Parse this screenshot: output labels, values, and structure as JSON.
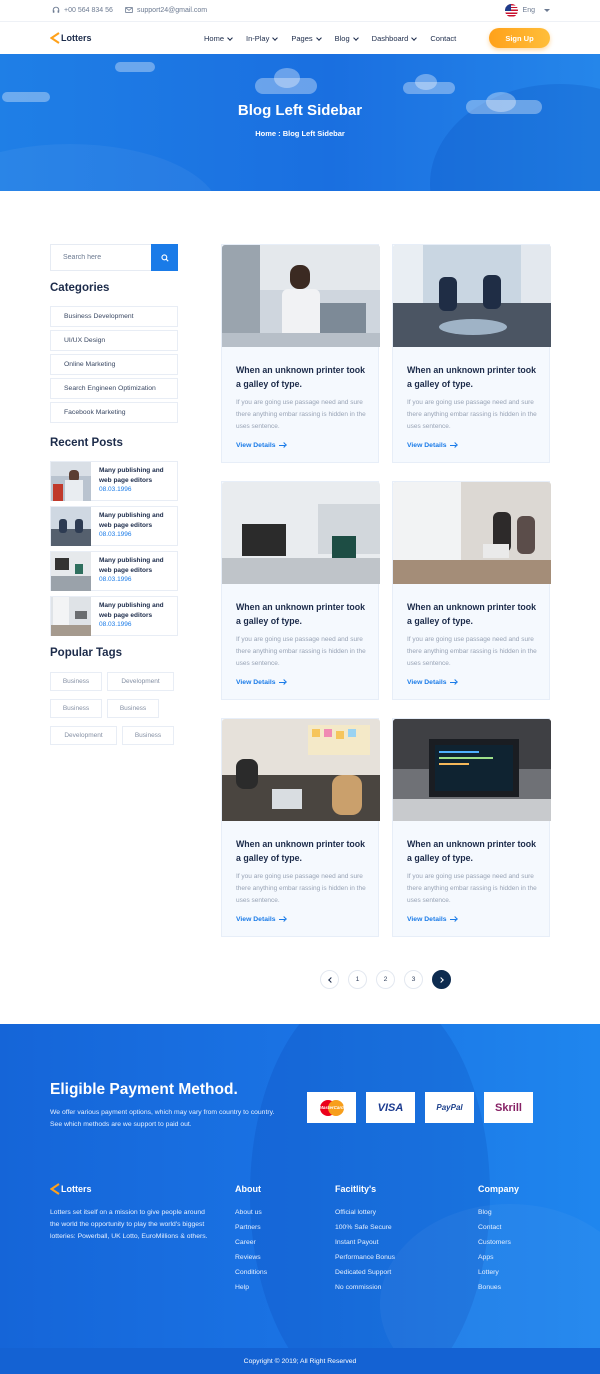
{
  "topbar": {
    "phone": "+00 564 834 56",
    "email": "support24@gmail.com",
    "language": "Eng"
  },
  "nav": {
    "logo": "Lotters",
    "items": [
      {
        "label": "Home",
        "has_dropdown": true
      },
      {
        "label": "In-Play",
        "has_dropdown": true
      },
      {
        "label": "Pages",
        "has_dropdown": true
      },
      {
        "label": "Blog",
        "has_dropdown": true
      },
      {
        "label": "Dashboard",
        "has_dropdown": true
      },
      {
        "label": "Contact",
        "has_dropdown": false
      }
    ],
    "signup": "Sign Up"
  },
  "hero": {
    "title": "Blog Left Sidebar",
    "breadcrumb": "Home : Blog Left Sidebar"
  },
  "sidebar": {
    "search_placeholder": "Search here",
    "categories_title": "Categories",
    "categories": [
      "Business Development",
      "UI/UX Design",
      "Online Marketing",
      "Search Engineen Optimization",
      "Facebook Marketing"
    ],
    "recent_title": "Recent Posts",
    "recent_posts": [
      {
        "title": "Many publishing and web page editors",
        "date": "08.03.1996"
      },
      {
        "title": "Many publishing and web page editors",
        "date": "08.03.1996"
      },
      {
        "title": "Many publishing and web page editors",
        "date": "08.03.1996"
      },
      {
        "title": "Many publishing and web page editors",
        "date": "08.03.1996"
      }
    ],
    "tags_title": "Popular Tags",
    "tags": [
      "Business",
      "Development",
      "Business",
      "Business",
      "Development",
      "Business"
    ]
  },
  "posts": [
    {
      "title": "When an unknown printer took a galley of type.",
      "excerpt": "If you are going use passage need and sure there anything embar rassing is hidden in the uses sentence.",
      "link": "View Details"
    },
    {
      "title": "When an unknown printer took a galley of type.",
      "excerpt": "If you are going use passage need and sure there anything embar rassing is hidden in the uses sentence.",
      "link": "View Details"
    },
    {
      "title": "When an unknown printer took a galley of type.",
      "excerpt": "If you are going use passage need and sure there anything embar rassing is hidden in the uses sentence.",
      "link": "View Details"
    },
    {
      "title": "When an unknown printer took a galley of type.",
      "excerpt": "If you are going use passage need and sure there anything embar rassing is hidden in the uses sentence.",
      "link": "View Details"
    },
    {
      "title": "When an unknown printer took a galley of type.",
      "excerpt": "If you are going use passage need and sure there anything embar rassing is hidden in the uses sentence.",
      "link": "View Details"
    },
    {
      "title": "When an unknown printer took a galley of type.",
      "excerpt": "If you are going use passage need and sure there anything embar rassing is hidden in the uses sentence.",
      "link": "View Details"
    }
  ],
  "pagination": {
    "pages": [
      "1",
      "2",
      "3"
    ]
  },
  "payment": {
    "title": "Eligible Payment Method.",
    "text": "We offer various payment options, which may vary from country to country. See which methods are we support to paid out.",
    "methods": [
      "MasterCard",
      "VISA",
      "PayPal",
      "Skrill"
    ]
  },
  "footer": {
    "logo": "Lotters",
    "about_text": "Lotters set itself on a mission to give people around the world the opportunity to play the world's biggest lotteries: Powerball, UK Lotto, EuroMillions & others.",
    "columns": [
      {
        "title": "About",
        "links": [
          "About us",
          "Partners",
          "Career",
          "Reviews",
          "Conditions",
          "Help"
        ]
      },
      {
        "title": "Facitlity's",
        "links": [
          "Official lottery",
          "100% Safe Secure",
          "Instant Payout",
          "Performance Bonus",
          "Dedicated Support",
          "No commission"
        ]
      },
      {
        "title": "Company",
        "links": [
          "Blog",
          "Contact",
          "Customers",
          "Apps",
          "Lottery",
          "Bonues"
        ]
      }
    ],
    "copyright": "Copyright © 2019; All Right Reserved"
  },
  "colors": {
    "primary": "#1a7be8",
    "accent": "#ffa11a",
    "dark": "#0d2b4f"
  }
}
